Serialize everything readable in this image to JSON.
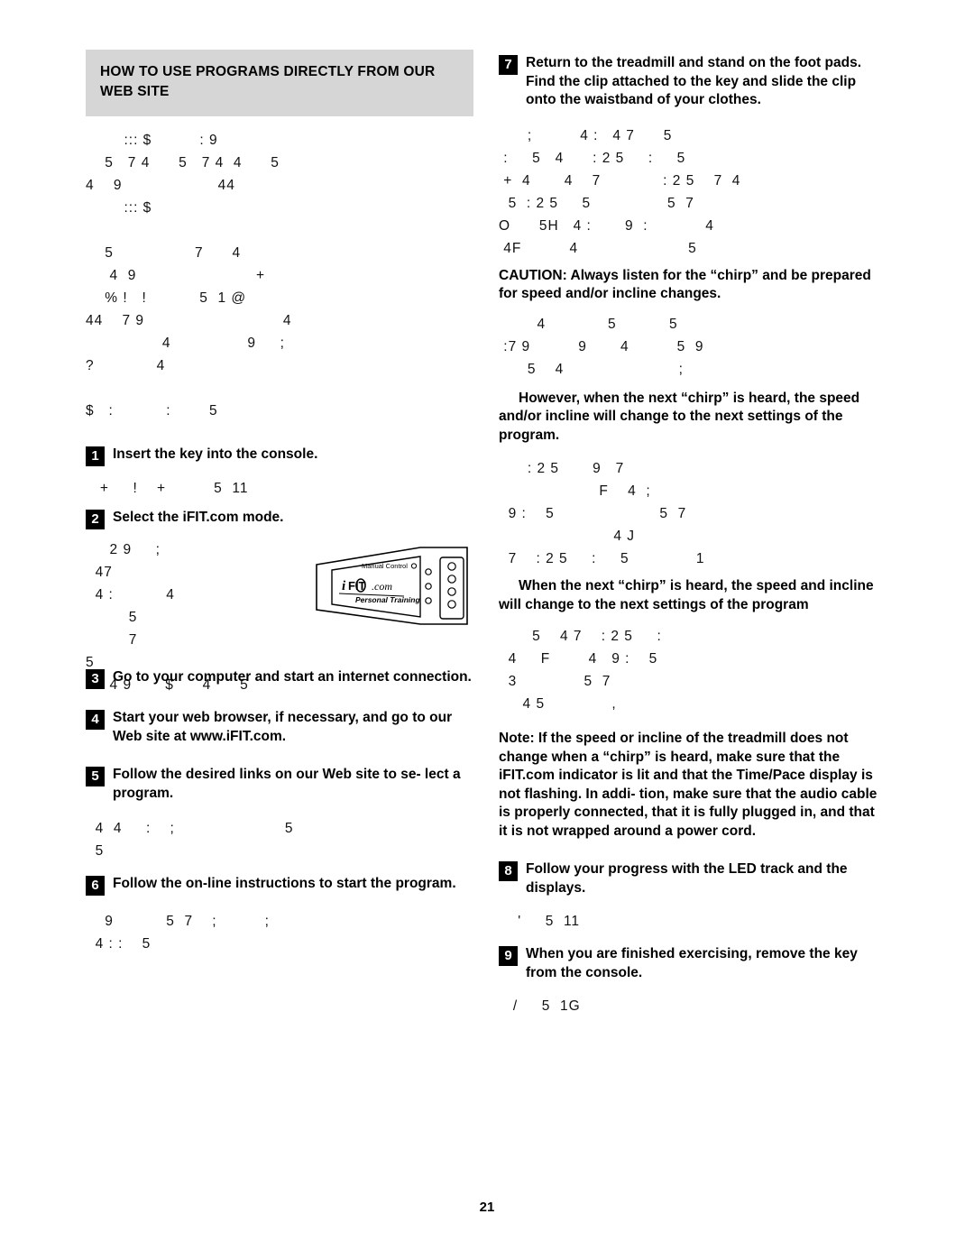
{
  "page": {
    "number": "21"
  },
  "left_column": {
    "header": "HOW TO USE PROGRAMS DIRECTLY FROM OUR WEB SITE",
    "garble_block_1": "        ::: $          : 9\n    5   7 4      5   7 4  4      5\n4    9                    44\n        ::: $\n\n    5                 7      4\n     4  9                         +\n    % !   !           5  1 @\n44    7 9                             4\n                4                9     ;\n?             4\n\n$   :           :        5",
    "steps": [
      {
        "number": "1",
        "text": "Insert the key into the console."
      },
      {
        "number": "2",
        "text": "Select the iFIT.com mode."
      },
      {
        "number": "3",
        "text": "Go to your computer and start an internet connection."
      },
      {
        "number": "4",
        "text": "Start your web browser, if necessary, and go to our Web site at www.iFIT.com."
      },
      {
        "number": "5",
        "text": "Follow the desired links on our Web site to se- lect a program."
      },
      {
        "number": "6",
        "text": "Follow the on-line instructions to start the program."
      }
    ],
    "garble_after_step1": "   +     !    +          5  11",
    "garble_after_step2": "     2 9     ;\n  47\n  4 :           4\n         5\n         7\n5\n     4 9       $      4      5",
    "garble_after_step5": "  4  4     :    ;                       5\n  5",
    "garble_after_step6": "    9           5  7    ;          ;\n  4 : :    5",
    "console_image": {
      "manual_control_label": "Manual Control",
      "brand": "iFIT.com",
      "tagline": "Personal Training"
    }
  },
  "right_column": {
    "steps": [
      {
        "number": "7",
        "text": "Return to the treadmill and stand on the foot pads. Find the clip attached to the key and slide the clip onto the waistband of your clothes."
      },
      {
        "number": "8",
        "text": "Follow your progress with the LED track and the displays."
      },
      {
        "number": "9",
        "text": "When you are finished exercising, remove the key from the console."
      }
    ],
    "garble_block_1": "      ;          4 :   4 7      5\n :     5   4      : 2 5     :     5\n +  4       4    7             : 2 5    7  4\n  5  : 2 5     5                5  7\nO      5H   4 :       9  :            4\n 4F          4                       5",
    "caution_text": "CAUTION: Always listen for the “chirp” and be prepared for speed and/or incline changes.",
    "garble_block_2": "        4             5           5\n :7 9          9       4          5  9\n      5    4                        ;",
    "however_text": "However, when the next “chirp” is heard, the speed and/or incline will change to the next settings of the program.",
    "garble_block_3": "      : 2 5       9   7\n                     F    4  ;\n  9 :    5                      5  7\n                        4 J\n  7    : 2 5     :     5              1",
    "when_next_text": "When the next “chirp” is heard, the speed and incline will change to the next settings of the program",
    "garble_block_4": "       5    4 7    : 2 5     :\n  4     F        4   9 :    5\n  3              5  7\n     4 5              ,",
    "note_text": "Note: If the speed or incline of the treadmill does not change when a “chirp” is heard, make sure that the iFIT.com indicator is lit and that the Time/Pace display is not flashing. In addi- tion, make sure that the audio cable is properly connected, that it is fully plugged in, and that it is not wrapped around a power cord.",
    "garble_after_step8": "    '     5  11",
    "garble_after_step9": "   /     5  1G"
  }
}
